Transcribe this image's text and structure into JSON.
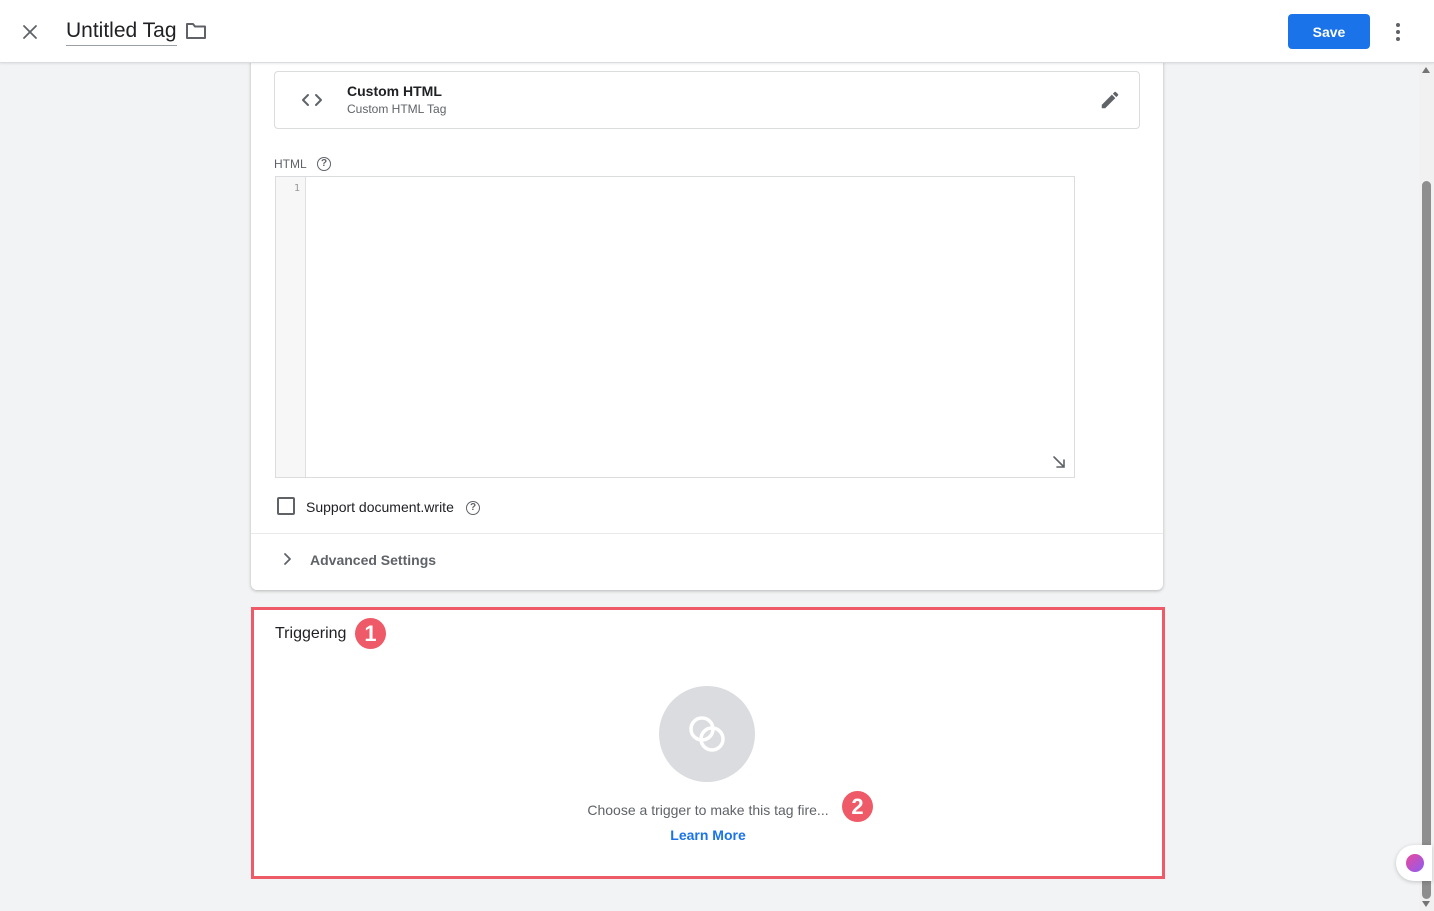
{
  "header": {
    "tag_title": "Untitled Tag",
    "save_label": "Save",
    "accent_color": "#1a73e8"
  },
  "tag_configuration": {
    "tag_type": {
      "name": "Custom HTML",
      "description": "Custom HTML Tag",
      "icon": "code-brackets-icon"
    },
    "html_label": "HTML",
    "editor": {
      "line_numbers": [
        "1"
      ],
      "content": ""
    },
    "support_document_write_label": "Support document.write",
    "support_document_write_checked": false,
    "advanced_settings_label": "Advanced Settings"
  },
  "triggering": {
    "title": "Triggering",
    "empty_hint": "Choose a trigger to make this tag fire...",
    "learn_more_label": "Learn More"
  },
  "annotations": {
    "marker_1": "1",
    "marker_2": "2",
    "highlight_color": "#ee5a67"
  }
}
